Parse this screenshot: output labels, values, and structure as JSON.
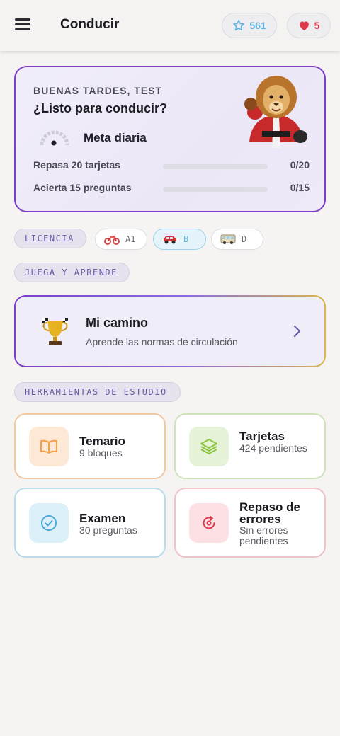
{
  "header": {
    "title": "Conducir",
    "stars": "561",
    "lives": "5",
    "icons": {
      "menu": "hamburger-menu-icon",
      "star": "star-icon",
      "heart": "heart-icon"
    }
  },
  "hero": {
    "greeting": "BUENAS TARDES, TEST",
    "title": "¿Listo para conducir?",
    "goal_label": "Meta diaria",
    "tasks": [
      {
        "label": "Repasa 20 tarjetas",
        "count": "0/20",
        "progress": 0
      },
      {
        "label": "Acierta 15 preguntas",
        "count": "0/15",
        "progress": 0
      }
    ]
  },
  "licence": {
    "label": "LICENCIA",
    "options": [
      {
        "code": "A1",
        "icon": "motorcycle-icon",
        "selected": false
      },
      {
        "code": "B",
        "icon": "car-icon",
        "selected": true
      },
      {
        "code": "D",
        "icon": "bus-icon",
        "selected": false
      }
    ]
  },
  "play": {
    "label": "JUEGA Y APRENDE",
    "card_title": "Mi camino",
    "card_subtitle": "Aprende las normas de circulación"
  },
  "tools": {
    "label": "HERRAMIENTAS DE ESTUDIO",
    "items": [
      {
        "title": "Temario",
        "subtitle": "9 bloques",
        "icon": "book-icon",
        "color": "#f2a049"
      },
      {
        "title": "Tarjetas",
        "subtitle": "424 pendientes",
        "icon": "layers-icon",
        "color": "#8cc63f"
      },
      {
        "title": "Examen",
        "subtitle": "30 preguntas",
        "icon": "check-circle-icon",
        "color": "#4aa8d8"
      },
      {
        "title": "Repaso de errores",
        "subtitle": "Sin errores pendientes",
        "icon": "refresh-icon",
        "color": "#e0394c"
      }
    ]
  },
  "colors": {
    "accent": "#7a3fc6",
    "selected_licence": "#67b8de"
  }
}
